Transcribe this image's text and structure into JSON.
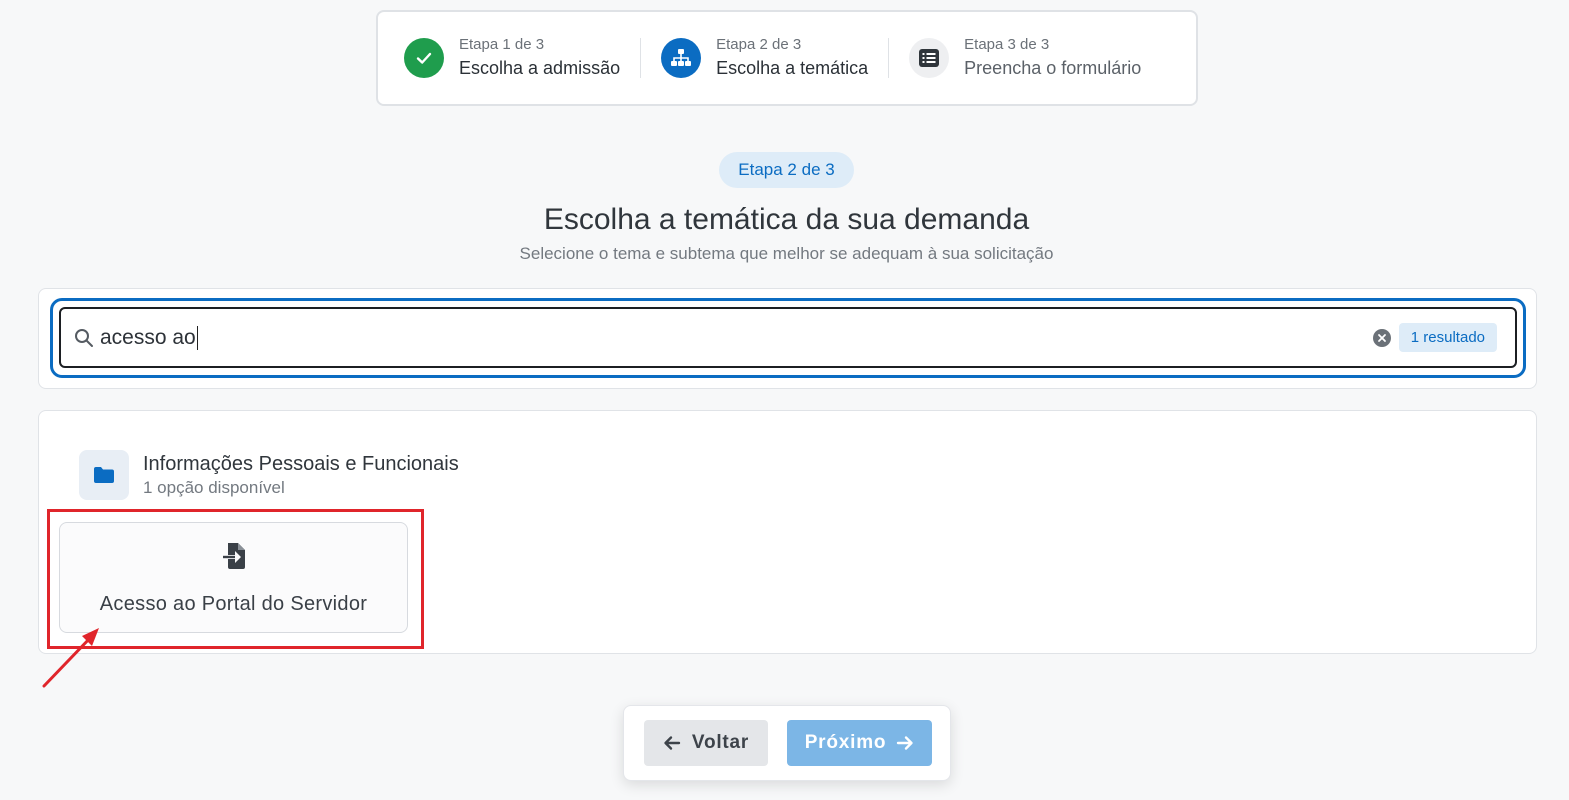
{
  "stepper": {
    "steps": [
      {
        "counter": "Etapa 1 de 3",
        "label": "Escolha a admissão",
        "status": "done",
        "icon": "check-icon"
      },
      {
        "counter": "Etapa 2 de 3",
        "label": "Escolha a temática",
        "status": "active",
        "icon": "sitemap-icon"
      },
      {
        "counter": "Etapa 3 de 3",
        "label": "Preencha o formulário",
        "status": "pending",
        "icon": "list-icon"
      }
    ]
  },
  "header": {
    "step_pill": "Etapa 2 de 3",
    "title": "Escolha a temática da sua demanda",
    "subtitle": "Selecione o tema e subtema que melhor se adequam à sua solicitação"
  },
  "search": {
    "value": "acesso ao",
    "result_count": "1 resultado"
  },
  "results": {
    "group": {
      "title": "Informações Pessoais e Funcionais",
      "count": "1 opção disponível",
      "icon": "folder-icon"
    },
    "options": [
      {
        "label": "Acesso ao Portal do Servidor",
        "icon": "file-import-icon"
      }
    ]
  },
  "nav": {
    "back_label": "Voltar",
    "next_label": "Próximo"
  },
  "colors": {
    "primary": "#0b6cc2",
    "success": "#1f9d4d",
    "annotation": "#e0252b",
    "next_button": "#7cb6e6"
  }
}
